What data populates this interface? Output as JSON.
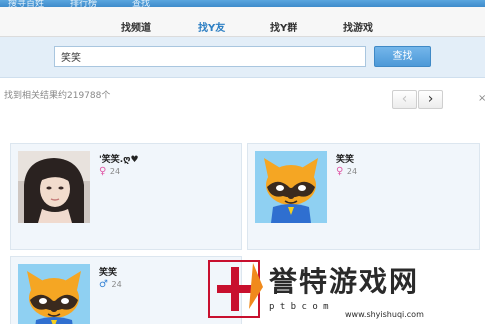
{
  "top_nav": {
    "items": [
      "搜寻百姓",
      "排行榜",
      "查找"
    ]
  },
  "tabs": [
    {
      "label": "找频道",
      "active": false
    },
    {
      "label": "找Y友",
      "active": true
    },
    {
      "label": "找Y群",
      "active": false
    },
    {
      "label": "找游戏",
      "active": false
    }
  ],
  "search": {
    "value": "笑笑",
    "button_label": "查找"
  },
  "results": {
    "summary": "找到相关结果约219788个",
    "prev": "‹",
    "next": "›",
    "close": "×"
  },
  "cards": [
    {
      "name": "'笑笑.ღ♥",
      "gender": "female",
      "gender_symbol": "♀",
      "age": "24",
      "avatar": "photo"
    },
    {
      "name": "笑笑",
      "gender": "female",
      "gender_symbol": "♀",
      "age": "24",
      "avatar": "raccoon-mascot"
    },
    {
      "name": "笑笑",
      "gender": "male",
      "gender_symbol": "♂",
      "age": "24",
      "avatar": "raccoon-mascot"
    }
  ],
  "watermark": {
    "text": "誉特游戏网",
    "url": "www.shyishuqi.com",
    "letters": "p t b c o m"
  },
  "colors": {
    "accent": "#2d7fc3",
    "female": "#e05aa8",
    "male": "#3a86d6",
    "watermark": "#c8102e"
  }
}
